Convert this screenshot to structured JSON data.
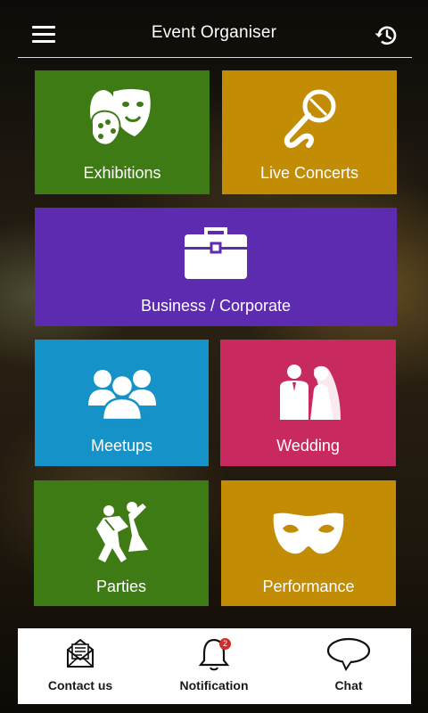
{
  "header": {
    "title": "Event Organiser"
  },
  "tiles": [
    {
      "label": "Exhibitions",
      "color": "#3f7b14",
      "icon": "theater-masks-icon"
    },
    {
      "label": "Live Concerts",
      "color": "#c28d05",
      "icon": "microphone-icon"
    },
    {
      "label": "Business / Corporate",
      "color": "#5c2bb0",
      "icon": "briefcase-icon"
    },
    {
      "label": "Meetups",
      "color": "#1592c8",
      "icon": "people-group-icon"
    },
    {
      "label": "Wedding",
      "color": "#c8295f",
      "icon": "couple-icon"
    },
    {
      "label": "Parties",
      "color": "#3f7b14",
      "icon": "dancing-couple-icon"
    },
    {
      "label": "Performance",
      "color": "#c28d05",
      "icon": "masquerade-mask-icon"
    }
  ],
  "bottom_nav": {
    "contact": {
      "label": "Contact us",
      "icon": "envelope-icon"
    },
    "notification": {
      "label": "Notification",
      "icon": "bell-icon",
      "badge": "2"
    },
    "chat": {
      "label": "Chat",
      "icon": "speech-bubble-icon"
    }
  }
}
